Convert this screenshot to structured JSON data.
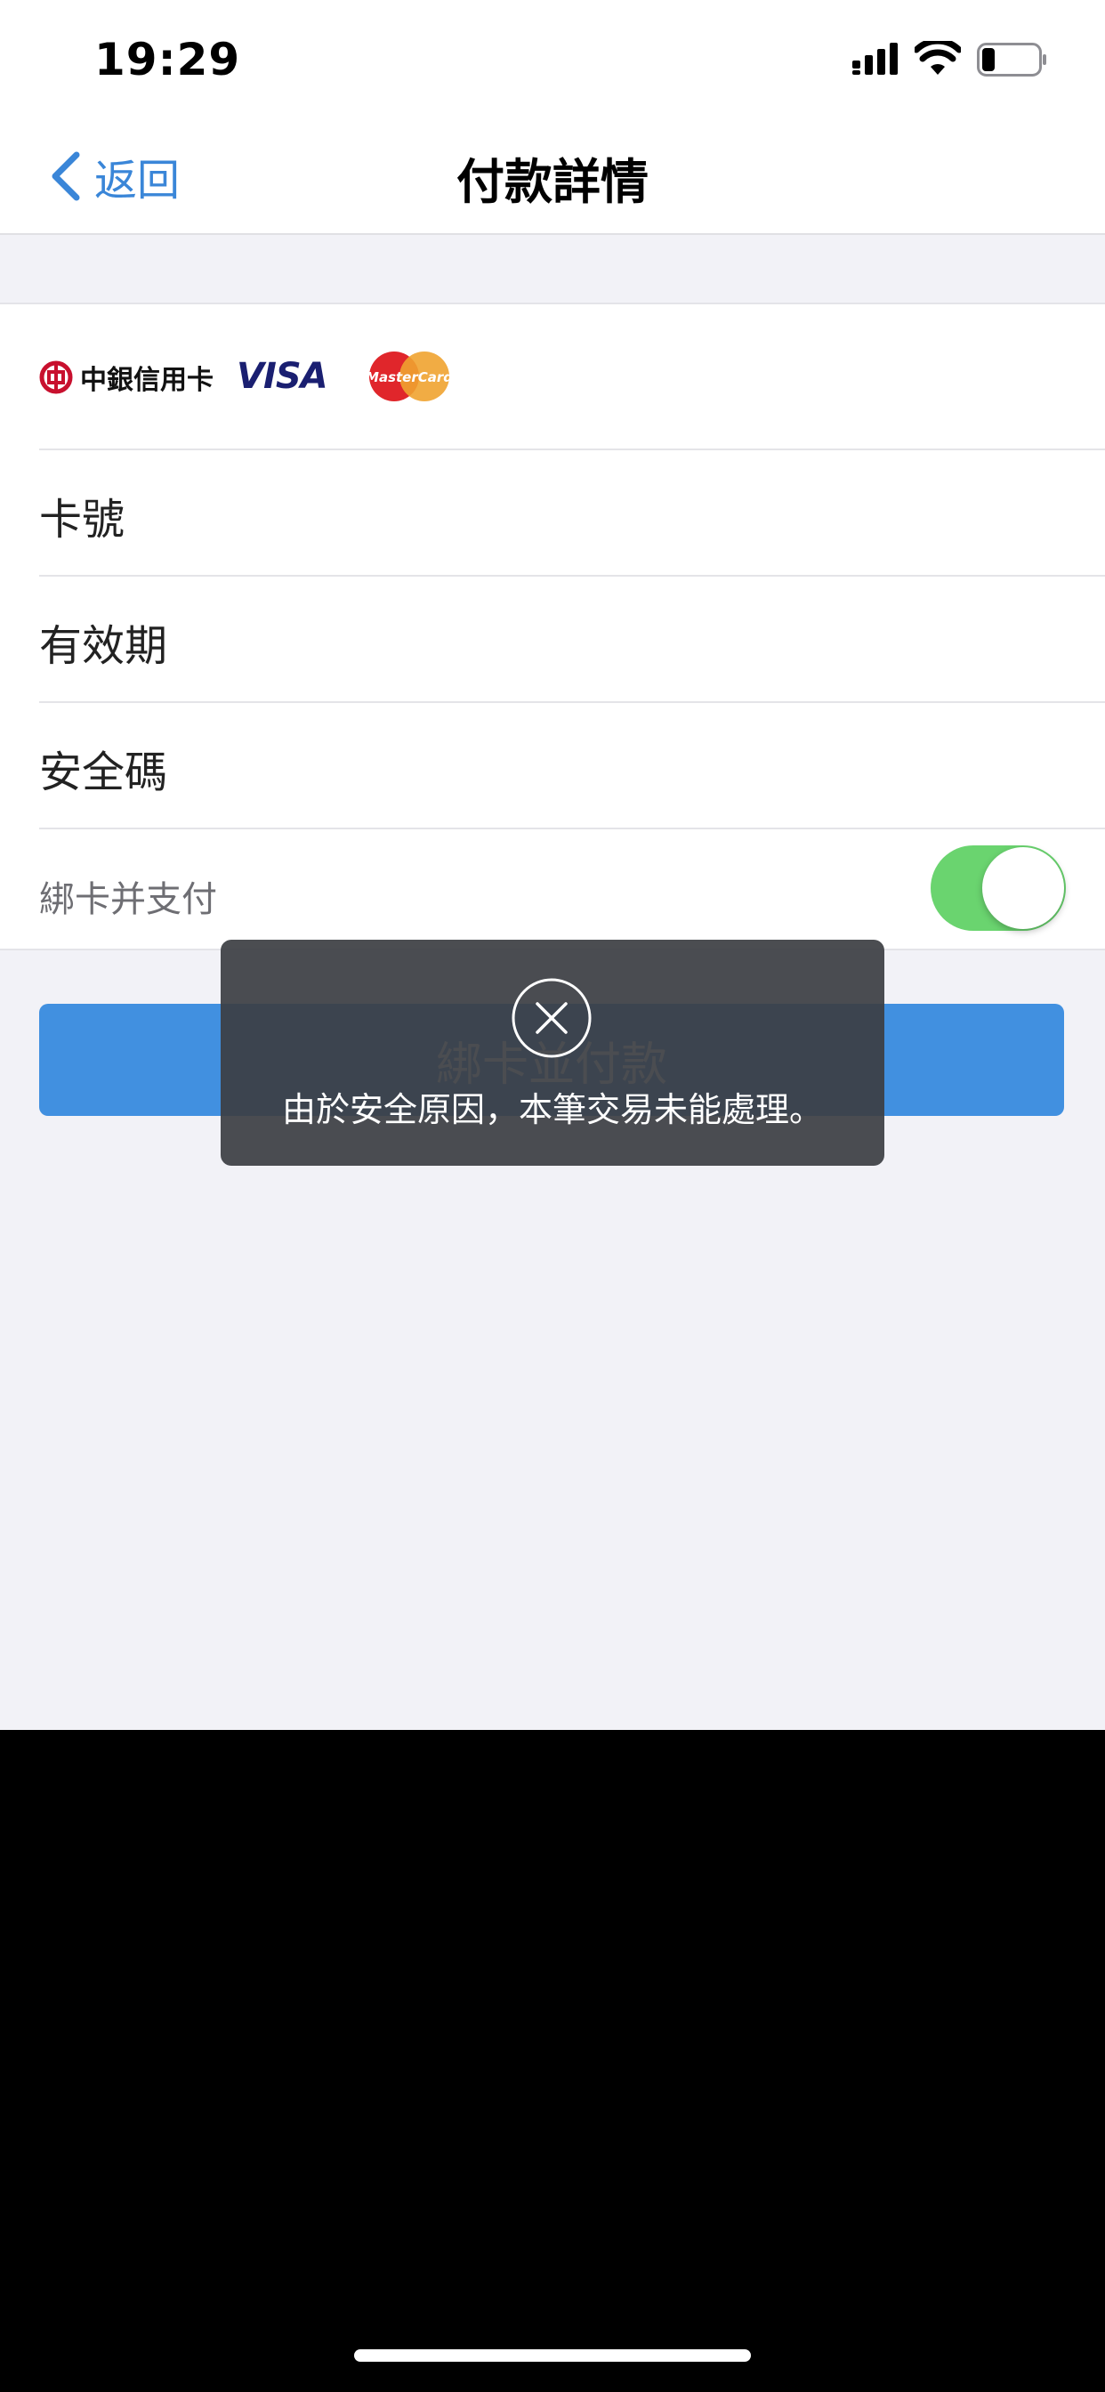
{
  "status_bar": {
    "time": "19:29"
  },
  "nav": {
    "back_label": "返回",
    "title": "付款詳情"
  },
  "card_logos": {
    "boc_text": "中銀信用卡",
    "visa_text": "VISA",
    "mastercard_text": "MasterCard"
  },
  "form": {
    "card_number_label": "卡號",
    "card_number_value": "",
    "expiry_label": "有效期",
    "expiry_value": "",
    "cvv_label": "安全碼",
    "cvv_value": "",
    "bind_toggle_label": "綁卡并支付",
    "bind_toggle_on": true
  },
  "primary_button": {
    "label": "綁卡並付款"
  },
  "toast": {
    "message": "由於安全原因，本筆交易未能處理。"
  },
  "colors": {
    "accent": "#3a86d8",
    "button": "#4190e0",
    "toggle_on": "#6ad46f",
    "visa_blue": "#1a1f71",
    "mc_red": "#e0262b",
    "mc_orange": "#f0a330"
  }
}
